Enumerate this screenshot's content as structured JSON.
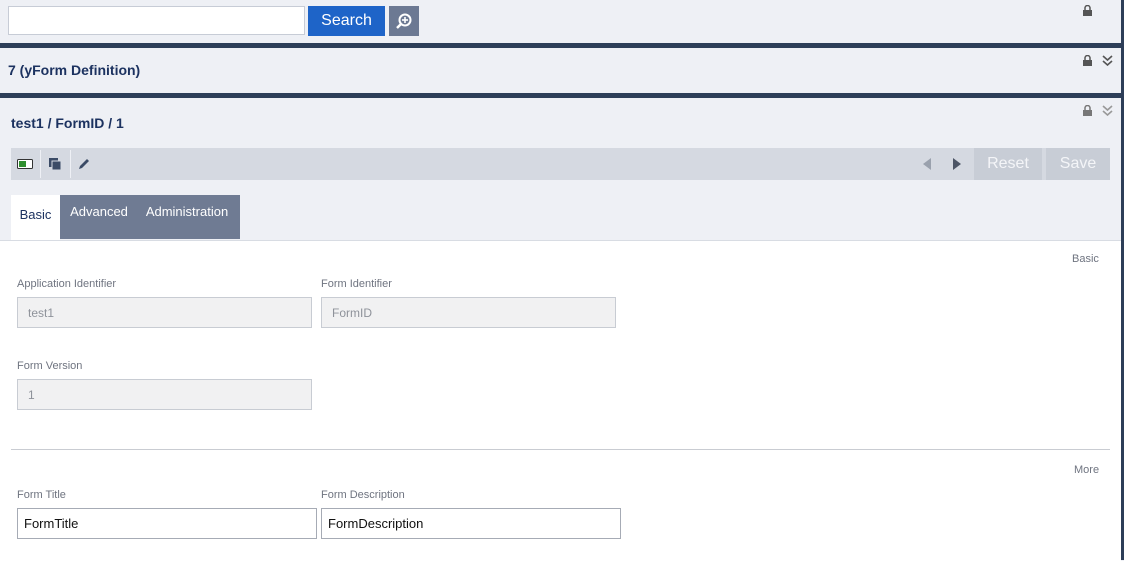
{
  "search": {
    "value": "",
    "button_label": "Search"
  },
  "list_panel": {
    "title": "7 (yForm Definition)"
  },
  "detail": {
    "title": "test1 / FormID / 1",
    "toolbar": {
      "reset_label": "Reset",
      "save_label": "Save"
    },
    "tabs": [
      {
        "label": "Basic",
        "active": true
      },
      {
        "label": "Advanced",
        "active": false
      },
      {
        "label": "Administration",
        "active": false
      }
    ],
    "sections": {
      "basic": {
        "label": "Basic",
        "fields": {
          "application_identifier": {
            "label": "Application Identifier",
            "value": "test1"
          },
          "form_identifier": {
            "label": "Form Identifier",
            "value": "FormID"
          },
          "form_version": {
            "label": "Form Version",
            "value": "1"
          }
        }
      },
      "more": {
        "label": "More",
        "fields": {
          "form_title": {
            "label": "Form Title",
            "value": "FormTitle"
          },
          "form_description": {
            "label": "Form Description",
            "value": "FormDescription"
          }
        }
      }
    }
  },
  "colors": {
    "primary_button": "#1e64c8",
    "dark_bar": "#2d3e58",
    "tab_bar": "#6f7b93"
  }
}
